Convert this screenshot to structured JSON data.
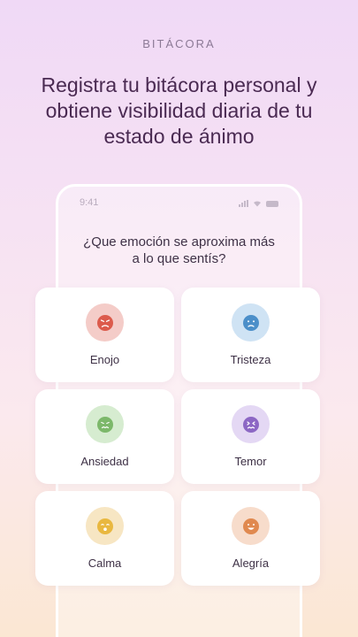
{
  "eyebrow": "BITÁCORA",
  "headline": "Registra tu bitácora personal y obtiene visibilidad diaria de tu estado de ánimo",
  "phone": {
    "time": "9:41",
    "question": "¿Que emoción se aproxima más a lo que sentís?"
  },
  "emotions": [
    {
      "label": "Enojo",
      "icon": "angry-face-icon",
      "ring": "#f4ccc8",
      "face": "#dc5b4c"
    },
    {
      "label": "Tristeza",
      "icon": "sad-face-icon",
      "ring": "#cfe3f4",
      "face": "#4b8fc9"
    },
    {
      "label": "Ansiedad",
      "icon": "anxious-face-icon",
      "ring": "#d6ecd0",
      "face": "#7cb86a"
    },
    {
      "label": "Temor",
      "icon": "fearful-face-icon",
      "ring": "#e4d8f4",
      "face": "#8c67c4"
    },
    {
      "label": "Calma",
      "icon": "calm-face-icon",
      "ring": "#f7e6c3",
      "face": "#e9b840"
    },
    {
      "label": "Alegría",
      "icon": "happy-face-icon",
      "ring": "#f7dccb",
      "face": "#e0894f"
    }
  ]
}
